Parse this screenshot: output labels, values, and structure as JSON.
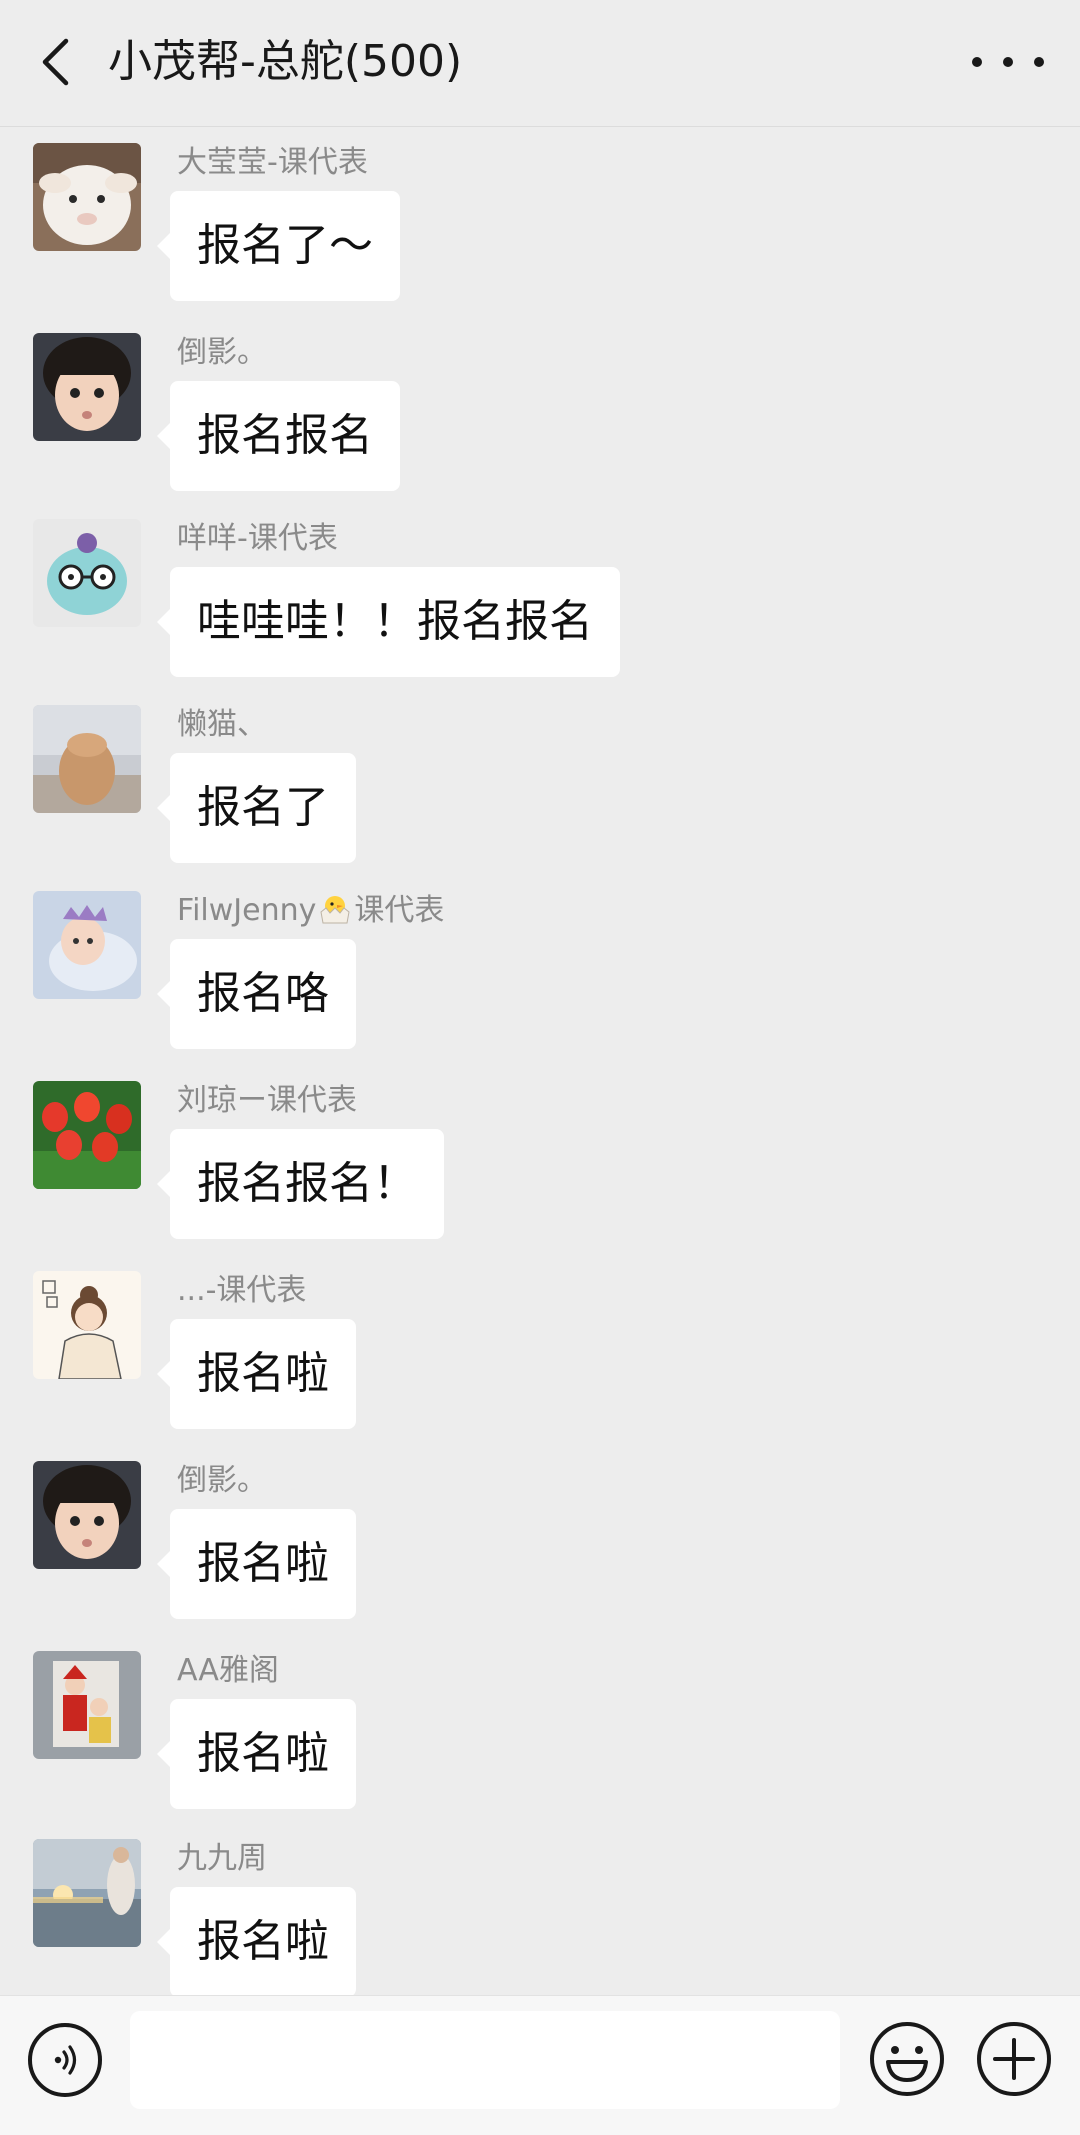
{
  "header": {
    "title": "小茂帮-总舵(500)",
    "back_icon": "chevron-left-icon",
    "more_icon": "more-horizontal-icon"
  },
  "messages": [
    {
      "sender": "大莹莹-课代表",
      "text": "报名了～",
      "avatar": "lamb-avatar"
    },
    {
      "sender": "倒影。",
      "text": "报名报名",
      "avatar": "little-girl-avatar"
    },
    {
      "sender": "咩咩-课代表",
      "text": "哇哇哇！！报名报名",
      "avatar": "octopus-toy-avatar"
    },
    {
      "sender": "懒猫、",
      "text": "报名了",
      "avatar": "cat-paw-avatar"
    },
    {
      "sender": "FilwJenny",
      "sender_suffix": "课代表",
      "sender_emoji": "hatching-chick-icon",
      "text": "报名咯",
      "avatar": "baby-crown-avatar"
    },
    {
      "sender": "刘琼ー课代表",
      "text": "报名报名！",
      "avatar": "tulips-avatar"
    },
    {
      "sender": "...-课代表",
      "text": "报名啦",
      "avatar": "cartoon-girl-avatar"
    },
    {
      "sender": "倒影。",
      "text": "报名啦",
      "avatar": "little-girl-avatar"
    },
    {
      "sender": "AA雅阁",
      "text": "报名啦",
      "avatar": "santa-photo-avatar"
    },
    {
      "sender": "九九周",
      "text": "报名啦",
      "avatar": "sunset-person-avatar"
    }
  ],
  "input_bar": {
    "voice_icon": "voice-icon",
    "emoji_icon": "emoji-icon",
    "plus_icon": "plus-circle-icon",
    "text_value": ""
  },
  "colors": {
    "background": "#ededed",
    "bubble": "#ffffff",
    "nickname": "#8a8a8a",
    "text": "#111111"
  }
}
